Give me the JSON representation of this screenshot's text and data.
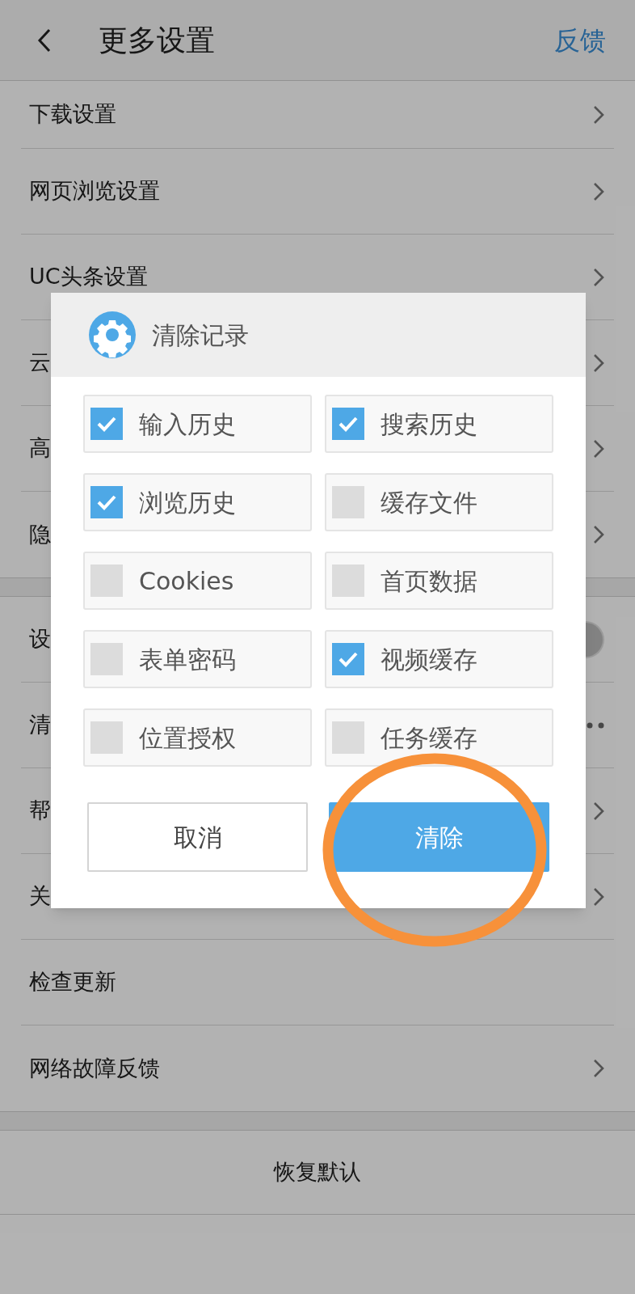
{
  "header": {
    "title": "更多设置",
    "action": "反馈"
  },
  "sections": [
    {
      "rows": [
        {
          "label": "下载设置",
          "kind": "chevron"
        },
        {
          "label": "网页浏览设置",
          "kind": "chevron"
        },
        {
          "label": "UC头条设置",
          "kind": "chevron"
        },
        {
          "label": "云",
          "kind": "chevron"
        },
        {
          "label": "高",
          "kind": "chevron"
        },
        {
          "label": "隐",
          "kind": "chevron"
        }
      ]
    },
    {
      "rows": [
        {
          "label": "设",
          "kind": "toggle",
          "on": false
        },
        {
          "label": "清",
          "kind": "dots"
        },
        {
          "label": "帮",
          "kind": "chevron"
        },
        {
          "label": "关",
          "kind": "chevron"
        },
        {
          "label": "检查更新",
          "kind": "none"
        },
        {
          "label": "网络故障反馈",
          "kind": "chevron"
        }
      ]
    }
  ],
  "reset": "恢复默认",
  "dialog": {
    "title": "清除记录",
    "options": [
      {
        "label": "输入历史",
        "checked": true
      },
      {
        "label": "搜索历史",
        "checked": true
      },
      {
        "label": "浏览历史",
        "checked": true
      },
      {
        "label": "缓存文件",
        "checked": false
      },
      {
        "label": "Cookies",
        "checked": false
      },
      {
        "label": "首页数据",
        "checked": false
      },
      {
        "label": "表单密码",
        "checked": false
      },
      {
        "label": "视频缓存",
        "checked": true
      },
      {
        "label": "位置授权",
        "checked": false
      },
      {
        "label": "任务缓存",
        "checked": false
      }
    ],
    "buttons": [
      {
        "label": "取消",
        "kind": "secondary"
      },
      {
        "label": "清除",
        "kind": "primary"
      }
    ]
  }
}
